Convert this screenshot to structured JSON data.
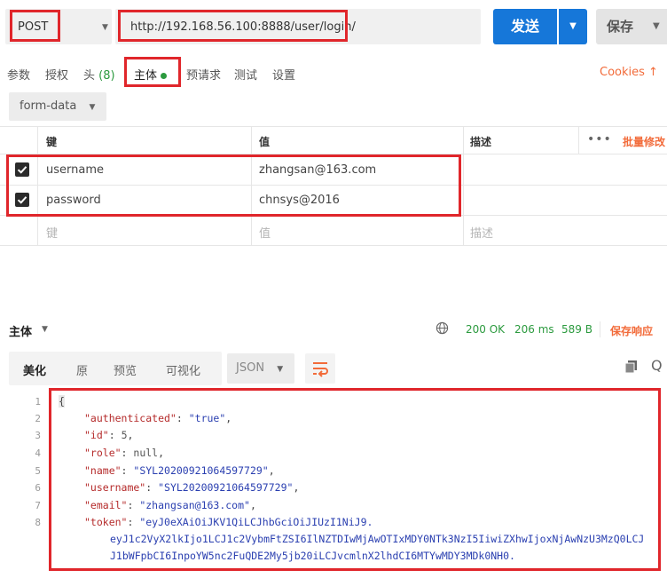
{
  "request": {
    "method": "POST",
    "url": "http://192.168.56.100:8888/user/login/",
    "send_label": "发送",
    "save_label": "保存"
  },
  "tabs": {
    "params": "参数",
    "auth": "授权",
    "headers": "头",
    "headers_count": "(8)",
    "body": "主体",
    "prerequest": "预请求",
    "tests": "测试",
    "settings": "设置",
    "cookies": "Cookies ↑"
  },
  "body_mode": "form-data",
  "table": {
    "header_key": "键",
    "header_value": "值",
    "header_desc": "描述",
    "bulk_edit": "批量修改",
    "rows": [
      {
        "key": "username",
        "value": "zhangsan@163.com"
      },
      {
        "key": "password",
        "value": "chnsys@2016"
      }
    ],
    "placeholder_key": "键",
    "placeholder_value": "值",
    "placeholder_desc": "描述"
  },
  "response": {
    "title": "主体",
    "status": "200 OK",
    "time": "206 ms",
    "size": "589 B",
    "save_response": "保存响应",
    "tabs": {
      "pretty": "美化",
      "raw": "原",
      "preview": "预览",
      "visualize": "可视化"
    },
    "format": "JSON",
    "line_numbers": [
      "1",
      "2",
      "3",
      "4",
      "5",
      "6",
      "7",
      "8"
    ],
    "json": {
      "open_brace": "{",
      "authenticated_key": "\"authenticated\"",
      "authenticated_val": "\"true\"",
      "id_key": "\"id\"",
      "id_val": "5",
      "role_key": "\"role\"",
      "role_val": "null",
      "name_key": "\"name\"",
      "name_val": "\"SYL20200921064597729\"",
      "username_key": "\"username\"",
      "username_val": "\"SYL20200921064597729\"",
      "email_key": "\"email\"",
      "email_val": "\"zhangsan@163.com\"",
      "token_key": "\"token\"",
      "token_line1": "\"eyJ0eXAiOiJKV1QiLCJhbGciOiJIUzI1NiJ9.",
      "token_line2": "eyJ1c2VyX2lkIjo1LCJ1c2VybmFtZSI6IlNZTDIwMjAwOTIxMDY0NTk3NzI5IiwiZXhwIjoxNjAwNzU3MzQ0LCJ",
      "token_line3": "J1bWFpbCI6InpoYW5nc2FuQDE2My5jb20iLCJvcmlnX2lhdCI6MTYwMDY3MDk0NH0."
    }
  },
  "colors": {
    "accent_blue": "#1677d9",
    "highlight_red": "#e0262b",
    "success_green": "#2b9a3e",
    "orange": "#f26b3a"
  }
}
